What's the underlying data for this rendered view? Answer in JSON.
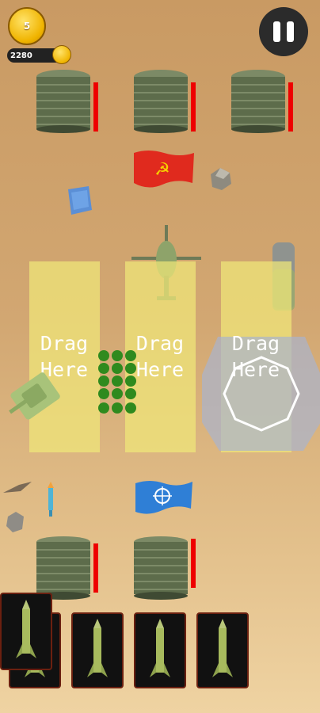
{
  "hud": {
    "level": "5",
    "coins": "2280"
  },
  "lanes": [
    {
      "label": "Drag\nHere"
    },
    {
      "label": "Drag\nHere"
    },
    {
      "label": "Drag\nHere"
    }
  ],
  "icons": {
    "enemy_flag": "soviet-flag-icon",
    "player_flag": "nato-flag-icon",
    "card_unit": "missile-icon",
    "pause": "pause-icon",
    "currency": "coin-icon"
  },
  "colors": {
    "lane_highlight": "#f0e878",
    "hp": "#e00000",
    "enemy_flag": "#e02a1e",
    "player_flag": "#2f7fd6"
  },
  "cards": [
    {
      "unit": "missile",
      "selected": true
    },
    {
      "unit": "missile",
      "selected": false
    },
    {
      "unit": "missile",
      "selected": false
    },
    {
      "unit": "missile",
      "selected": false
    },
    {
      "unit": "missile",
      "selected": false
    }
  ]
}
